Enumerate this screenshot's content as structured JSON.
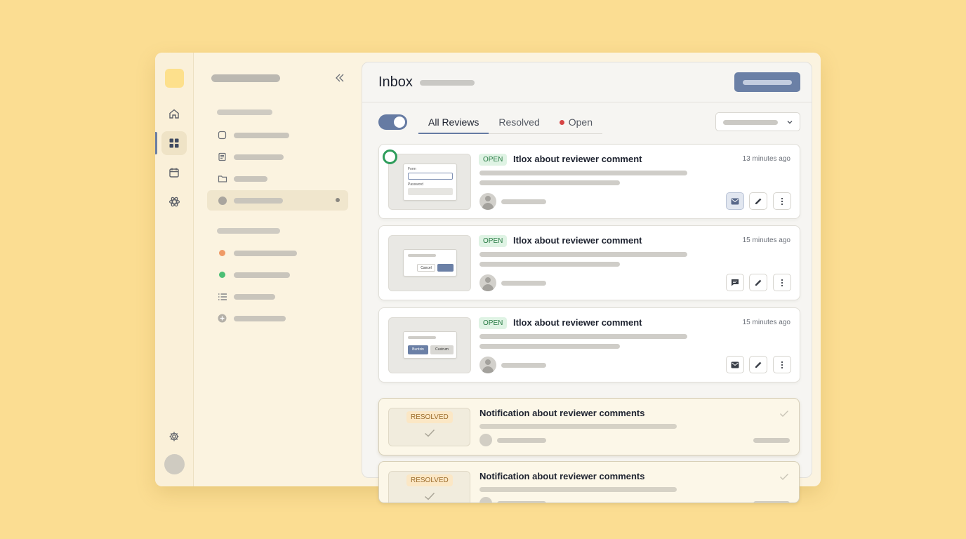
{
  "header": {
    "title": "Inbox"
  },
  "tabs": [
    {
      "label": "All Reviews",
      "active": true
    },
    {
      "label": "Resolved",
      "active": false
    },
    {
      "label": "Open",
      "active": false,
      "dot_color": "#d64545"
    }
  ],
  "cards": [
    {
      "badge": "OPEN",
      "title": "Itlox about reviewer comment",
      "time": "13 minutes ago",
      "thumb": {
        "label1": "Form",
        "label2": "Password"
      }
    },
    {
      "badge": "OPEN",
      "title": "Itlox about reviewer comment",
      "time": "15 minutes ago",
      "thumb": {
        "cancel": "Cancel"
      }
    },
    {
      "badge": "OPEN",
      "title": "Itlox about reviewer comment",
      "time": "15 minutes ago",
      "thumb": {
        "btn1": "Buntzin",
        "btn2": "Custrum"
      }
    }
  ],
  "resolved_cards": [
    {
      "badge": "RESOLVED",
      "title": "Notification about reviewer comments"
    },
    {
      "badge": "RESOLVED",
      "title": "Notification about reviewer comments"
    }
  ],
  "colors": {
    "background": "#fbdd92",
    "accent": "#6b80a6",
    "open_badge": "#267a42",
    "resolved_badge": "#9b6b2a",
    "status_orange": "#ef9a66",
    "status_green": "#4cbf75"
  }
}
